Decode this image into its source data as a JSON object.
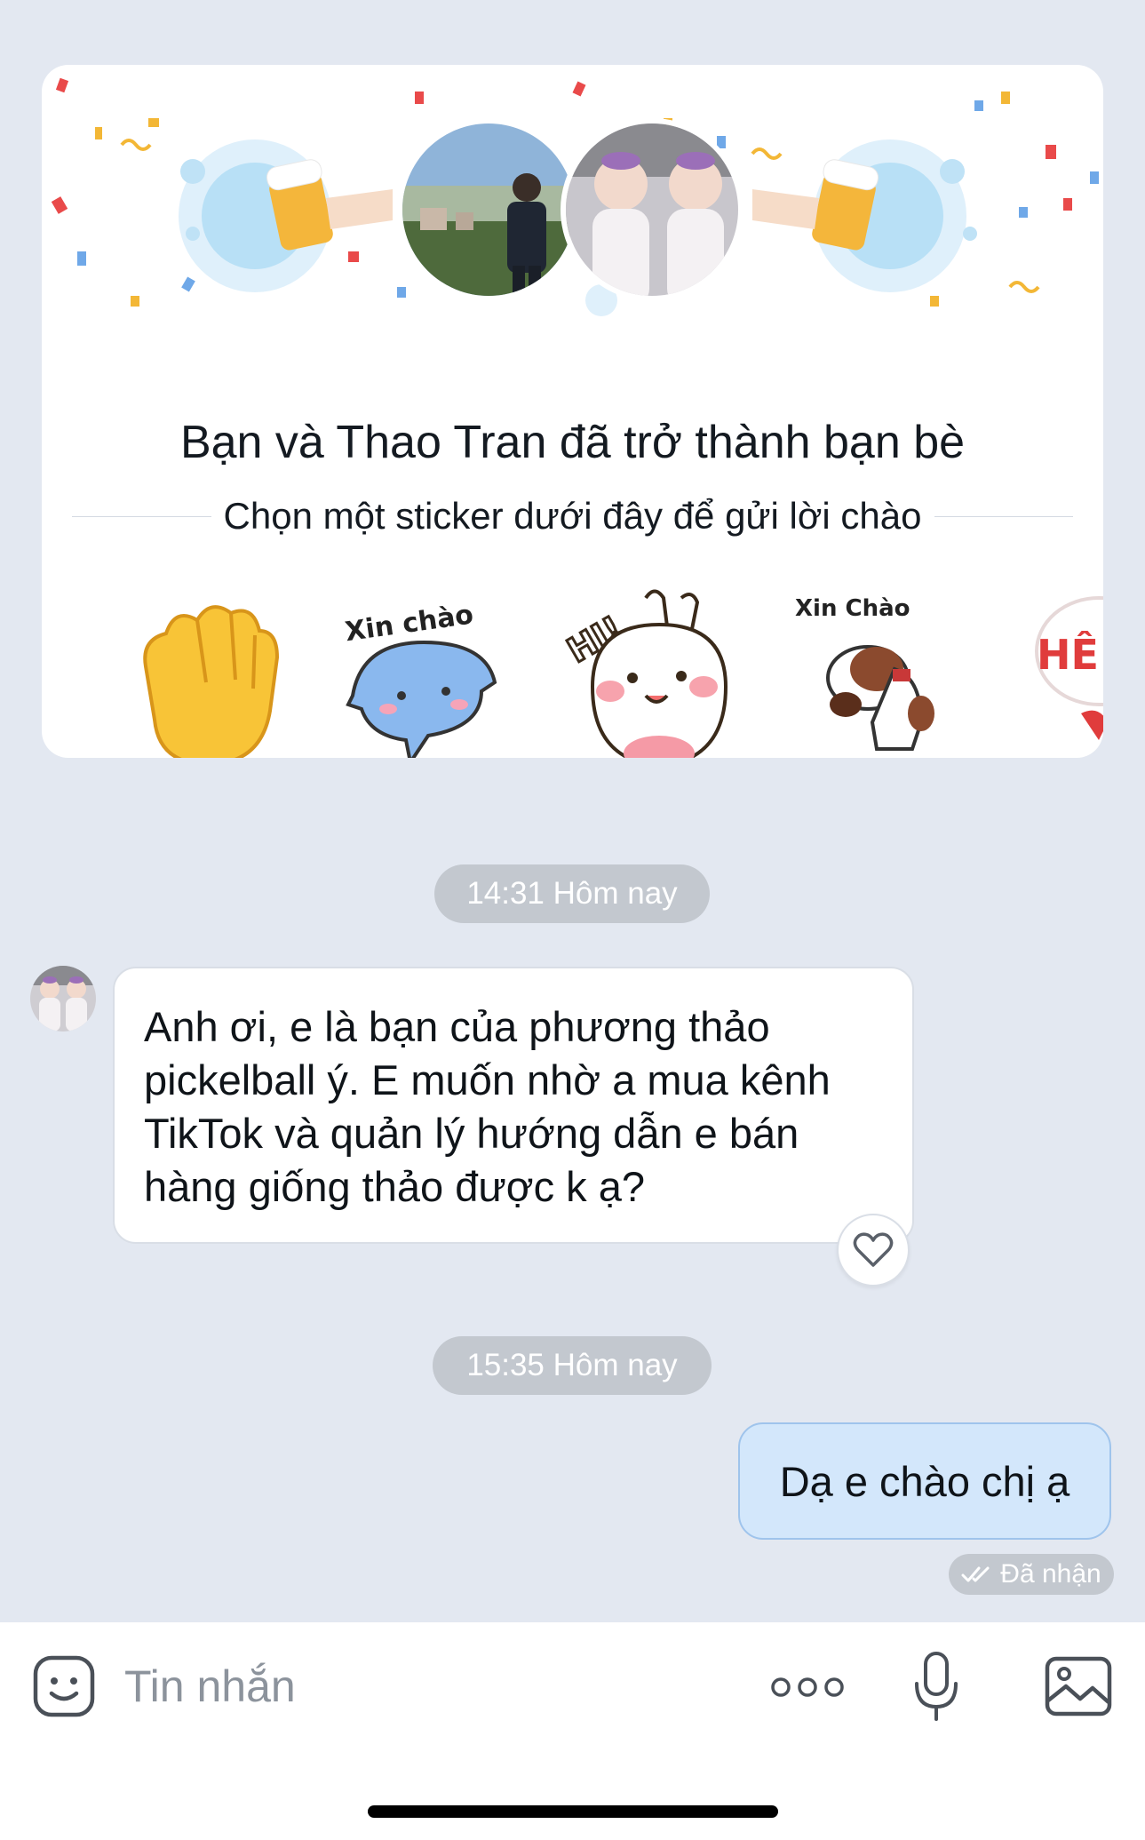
{
  "friend_card": {
    "title": "Bạn và Thao Tran đã trở thành bạn bè",
    "subtitle": "Chọn một sticker dưới đây để gửi lời chào",
    "stickers": [
      {
        "icon": "waving-hand-icon",
        "text": ""
      },
      {
        "icon": "blue-cat-sticker-icon",
        "text": "Xin chào"
      },
      {
        "icon": "bunny-hi-sticker-icon",
        "text": "HI!"
      },
      {
        "icon": "dog-bow-sticker-icon",
        "text": "Xin Chào"
      },
      {
        "icon": "partial-sticker-icon",
        "text": "HÊ"
      }
    ]
  },
  "messages": {
    "timestamp_1": "14:31 Hôm nay",
    "incoming_text": "Anh ơi, e là bạn của phương thảo\npickelball ý. E muốn nhờ a mua kênh\nTikTok và quản lý hướng dẫn e bán\nhàng giống thảo được k ạ?",
    "timestamp_2": "15:35 Hôm nay",
    "outgoing_text": "Dạ e chào chị ạ",
    "status": "Đã nhận"
  },
  "input_bar": {
    "placeholder": "Tin nhắn"
  },
  "colors": {
    "background": "#e3e8f1",
    "outgoing_bubble": "#d3e7fb",
    "pill": "#c3c8cf"
  }
}
